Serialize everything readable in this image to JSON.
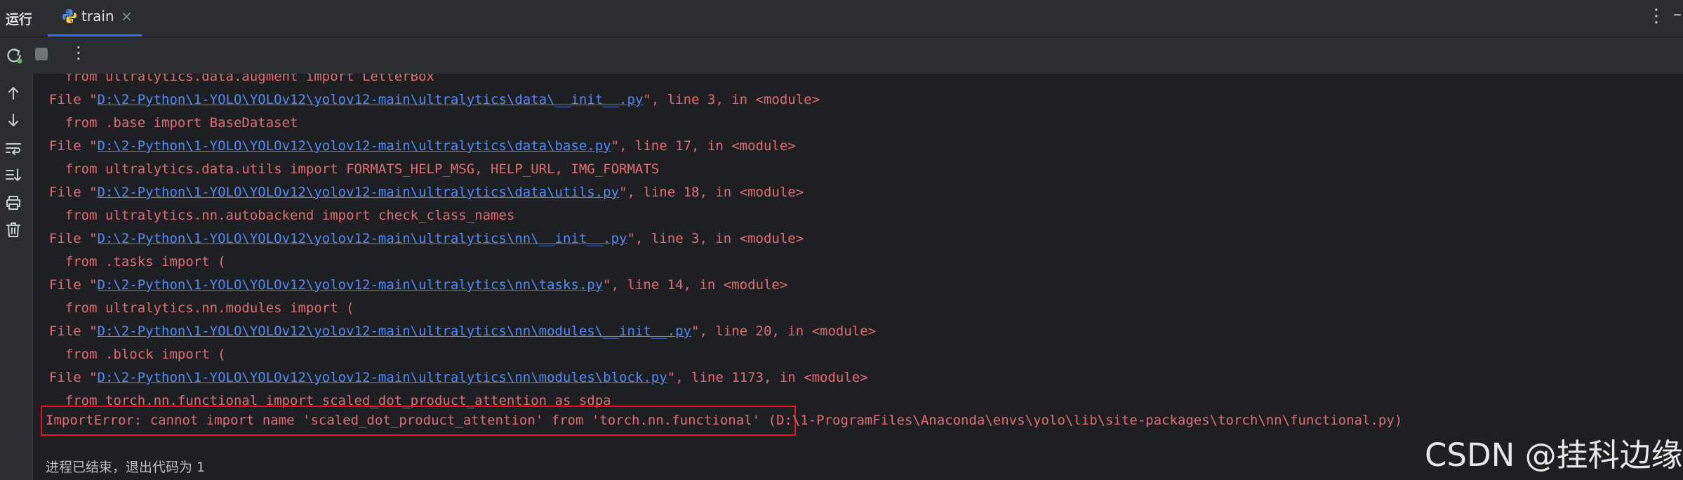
{
  "tool_window": {
    "title": "运行"
  },
  "tab": {
    "label": "train",
    "close": "×"
  },
  "header": {
    "more": "⋮",
    "minimize": "–"
  },
  "toolbar": {
    "more": "⋮"
  },
  "console": {
    "top_cut_line": "    from ultralytics.data.augment import LetterBox",
    "frames": [
      {
        "prefix": "  File \"",
        "path": "D:\\2-Python\\1-YOLO\\YOLOv12\\yolov12-main\\ultralytics\\data\\__init__.py",
        "suffix": "\", line 3, in <module>",
        "code": "    from .base import BaseDataset"
      },
      {
        "prefix": "  File \"",
        "path": "D:\\2-Python\\1-YOLO\\YOLOv12\\yolov12-main\\ultralytics\\data\\base.py",
        "suffix": "\", line 17, in <module>",
        "code": "    from ultralytics.data.utils import FORMATS_HELP_MSG, HELP_URL, IMG_FORMATS"
      },
      {
        "prefix": "  File \"",
        "path": "D:\\2-Python\\1-YOLO\\YOLOv12\\yolov12-main\\ultralytics\\data\\utils.py",
        "suffix": "\", line 18, in <module>",
        "code": "    from ultralytics.nn.autobackend import check_class_names"
      },
      {
        "prefix": "  File \"",
        "path": "D:\\2-Python\\1-YOLO\\YOLOv12\\yolov12-main\\ultralytics\\nn\\__init__.py",
        "suffix": "\", line 3, in <module>",
        "code": "    from .tasks import ("
      },
      {
        "prefix": "  File \"",
        "path": "D:\\2-Python\\1-YOLO\\YOLOv12\\yolov12-main\\ultralytics\\nn\\tasks.py",
        "suffix": "\", line 14, in <module>",
        "code": "    from ultralytics.nn.modules import ("
      },
      {
        "prefix": "  File \"",
        "path": "D:\\2-Python\\1-YOLO\\YOLOv12\\yolov12-main\\ultralytics\\nn\\modules\\__init__.py",
        "suffix": "\", line 20, in <module>",
        "code": "    from .block import ("
      },
      {
        "prefix": "  File \"",
        "path": "D:\\2-Python\\1-YOLO\\YOLOv12\\yolov12-main\\ultralytics\\nn\\modules\\block.py",
        "suffix": "\", line 1173, in <module>",
        "code": "    from torch.nn.functional import scaled_dot_product_attention as sdpa"
      }
    ],
    "error_message": "ImportError: cannot import name 'scaled_dot_product_attention' from 'torch.nn.functional'",
    "error_location": " (D:\\1-ProgramFiles\\Anaconda\\envs\\yolo\\lib\\site-packages\\torch\\nn\\functional.py)",
    "exit_message": "进程已结束，退出代码为 1"
  },
  "watermark": "CSDN @挂科边缘",
  "colors": {
    "background": "#1e1f22",
    "panel": "#2b2d30",
    "error_text": "#e06c75",
    "link": "#548af7",
    "tab_accent": "#3574f0",
    "highlight_box": "#e11b1b"
  }
}
